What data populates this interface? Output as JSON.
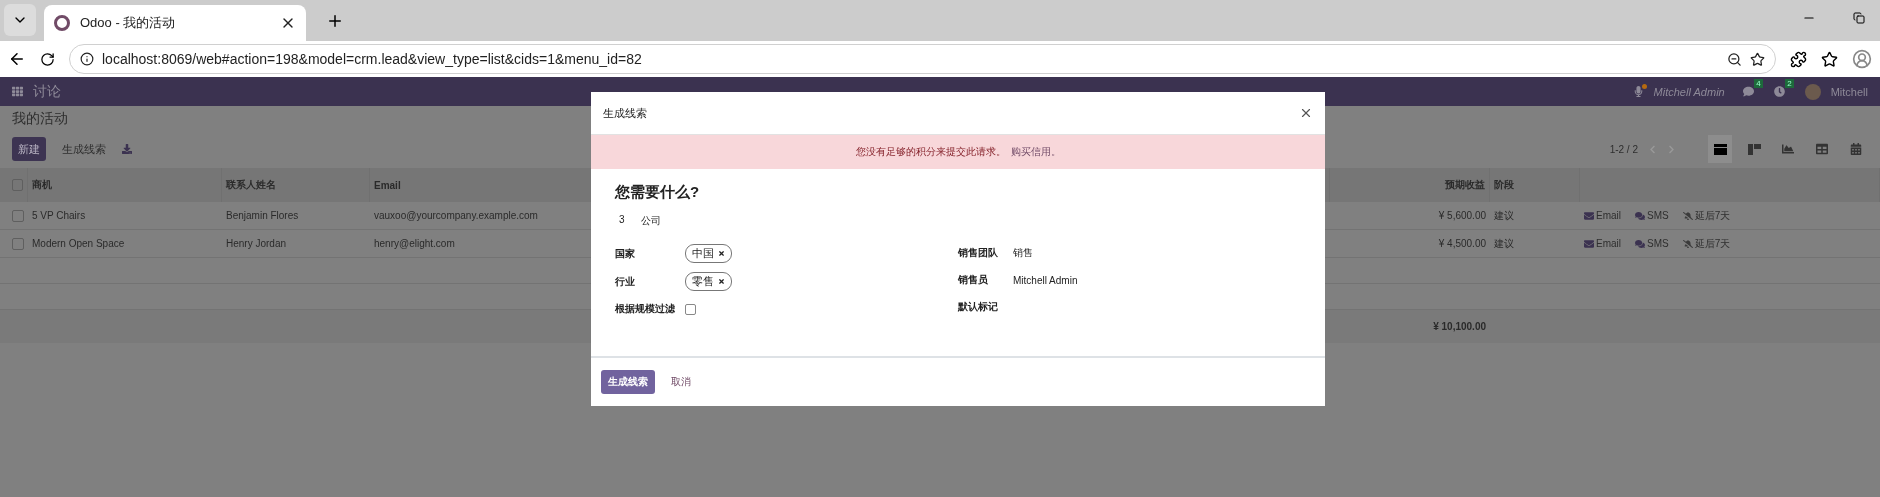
{
  "browser": {
    "tab_title": "Odoo - 我的活动",
    "url": "localhost:8069/web#action=198&model=crm.lead&view_type=list&cids=1&menu_id=82"
  },
  "navbar": {
    "app": "讨论",
    "status_user": "Mitchell Admin",
    "messages_count": "4",
    "activities_count": "2",
    "user": "Mitchell"
  },
  "page": {
    "title": "我的活动",
    "new_button": "新建",
    "generate_button": "生成线索",
    "pager": "1-2 / 2",
    "views": [
      {
        "kind": "list",
        "selected": true
      },
      {
        "kind": "kanban",
        "selected": false
      },
      {
        "kind": "graph",
        "selected": false
      },
      {
        "kind": "pivot",
        "selected": false
      },
      {
        "kind": "calendar",
        "selected": false
      }
    ]
  },
  "table": {
    "select_all_checked": false,
    "columns": [
      "商机",
      "联系人姓名",
      "Email",
      "预期收益",
      "阶段"
    ],
    "rows": [
      {
        "checked": false,
        "cells": [
          "5 VP Chairs",
          "Benjamin Flores",
          "vauxoo@yourcompany.example.com",
          "¥ 5,600.00",
          "建议"
        ],
        "actions": [
          "Email",
          "SMS",
          "延后7天"
        ]
      },
      {
        "checked": false,
        "cells": [
          "Modern Open Space",
          "Henry Jordan",
          "henry@elight.com",
          "¥ 4,500.00",
          "建议"
        ],
        "actions": [
          "Email",
          "SMS",
          "延后7天"
        ]
      }
    ],
    "total": "¥ 10,100.00"
  },
  "dialog": {
    "title": "生成线索",
    "alert": "您没有足够的积分来提交此请求。",
    "alert_link": "购买信用。",
    "heading": "您需要什么?",
    "count": "3",
    "target": "公司",
    "left_fields": [
      {
        "kind": "tags",
        "label": "国家",
        "tags": [
          "中国"
        ]
      },
      {
        "kind": "tags",
        "label": "行业",
        "tags": [
          "零售"
        ]
      },
      {
        "kind": "checkbox",
        "label": "根据规模过滤",
        "checked": false
      }
    ],
    "right_fields": [
      {
        "kind": "text",
        "label": "销售团队",
        "value": "销售"
      },
      {
        "kind": "text",
        "label": "销售员",
        "value": "Mitchell Admin"
      },
      {
        "kind": "empty",
        "label": "默认标记"
      }
    ],
    "primary_button": "生成线索",
    "cancel_button": "取消"
  }
}
